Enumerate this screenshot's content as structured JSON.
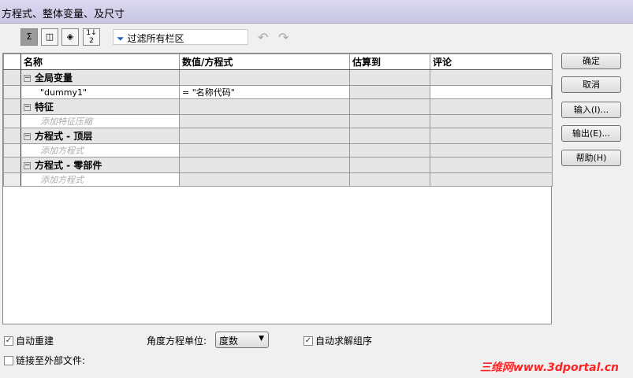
{
  "window": {
    "title": "方程式、整体变量、及尺寸"
  },
  "toolbar": {
    "filter_placeholder": "过滤所有栏区",
    "undo": "↶",
    "redo": "↷"
  },
  "table": {
    "headers": [
      "名称",
      "数值/方程式",
      "估算到",
      "评论"
    ],
    "groups": [
      {
        "label": "全局变量",
        "rows": [
          {
            "name": "\"dummy1\"",
            "value": "= \"名称代码\"",
            "placeholder": false
          }
        ]
      },
      {
        "label": "特征",
        "rows": [
          {
            "name": "添加特征压缩",
            "value": "",
            "placeholder": true
          }
        ]
      },
      {
        "label": "方程式 - 顶层",
        "rows": [
          {
            "name": "添加方程式",
            "value": "",
            "placeholder": true
          }
        ]
      },
      {
        "label": "方程式 - 零部件",
        "rows": [
          {
            "name": "添加方程式",
            "value": "",
            "placeholder": true
          }
        ]
      }
    ]
  },
  "buttons": {
    "ok": "确定",
    "cancel": "取消",
    "import": "输入(I)...",
    "export": "输出(E)...",
    "help": "帮助(H)"
  },
  "options": {
    "auto_rebuild": "自动重建",
    "auto_rebuild_checked": true,
    "angle_unit_label": "角度方程单位:",
    "angle_unit_value": "度数",
    "auto_solve": "自动求解组序",
    "auto_solve_checked": true,
    "link_external": "链接至外部文件:",
    "link_external_checked": false
  },
  "watermark": "三维网www.3dportal.cn"
}
